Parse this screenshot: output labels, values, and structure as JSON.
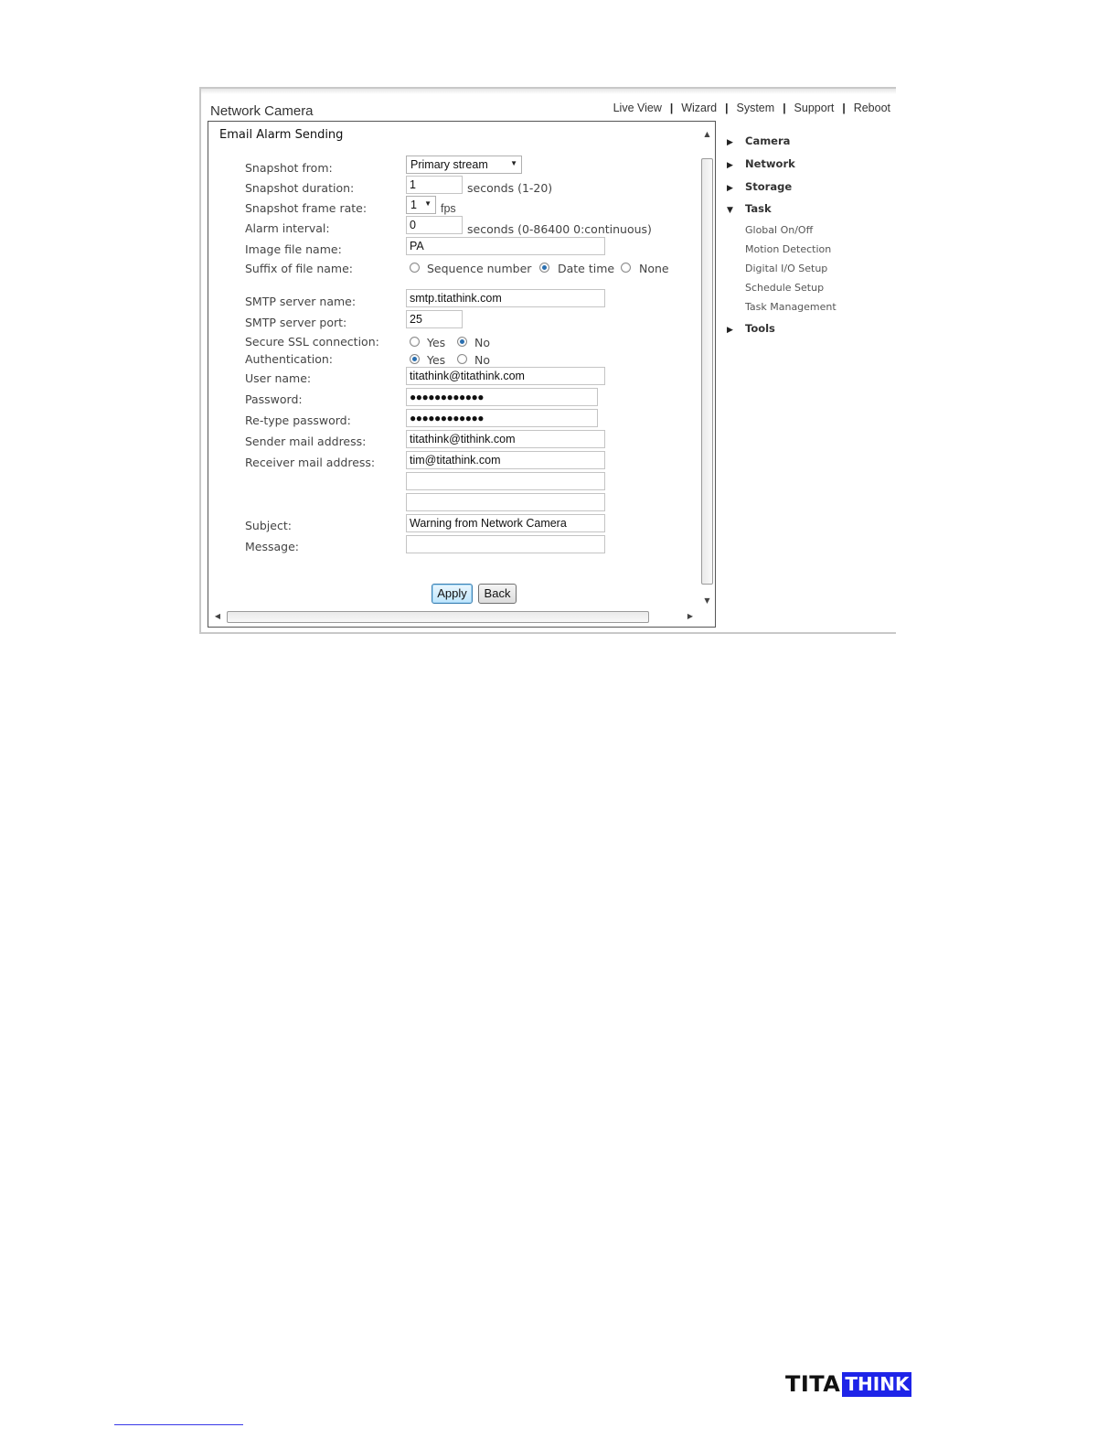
{
  "app": {
    "title": "Network Camera"
  },
  "topnav": [
    "Live View",
    "Wizard",
    "System",
    "Support",
    "Reboot"
  ],
  "panel": {
    "title": "Email Alarm Sending"
  },
  "form": {
    "snapshot_from": {
      "label": "Snapshot from:",
      "value": "Primary stream"
    },
    "snapshot_duration": {
      "label": "Snapshot duration:",
      "value": "1",
      "unit": "seconds (1-20)"
    },
    "snapshot_frame_rate": {
      "label": "Snapshot frame rate:",
      "value": "1",
      "unit": "fps"
    },
    "alarm_interval": {
      "label": "Alarm interval:",
      "value": "0",
      "unit": "seconds (0-86400 0:continuous)"
    },
    "image_file_name": {
      "label": "Image file name:",
      "value": "PA"
    },
    "suffix": {
      "label": "Suffix of file name:",
      "options": [
        "Sequence number",
        "Date time",
        "None"
      ],
      "selected": "Date time"
    },
    "smtp_server_name": {
      "label": "SMTP server name:",
      "value": "smtp.titathink.com"
    },
    "smtp_server_port": {
      "label": "SMTP server port:",
      "value": "25"
    },
    "secure_ssl": {
      "label": "Secure SSL connection:",
      "options": [
        "Yes",
        "No"
      ],
      "selected": "No"
    },
    "authentication": {
      "label": "Authentication:",
      "options": [
        "Yes",
        "No"
      ],
      "selected": "Yes"
    },
    "user_name": {
      "label": "User name:",
      "value": "titathink@titathink.com"
    },
    "password": {
      "label": "Password:",
      "value": "●●●●●●●●●●●●"
    },
    "retype_password": {
      "label": "Re-type password:",
      "value": "●●●●●●●●●●●●"
    },
    "sender": {
      "label": "Sender mail address:",
      "value": "titathink@tithink.com"
    },
    "receiver": {
      "label": "Receiver mail address:",
      "values": [
        "tim@titathink.com",
        "",
        ""
      ]
    },
    "subject": {
      "label": "Subject:",
      "value": "Warning from Network Camera"
    },
    "message": {
      "label": "Message:",
      "value": ""
    }
  },
  "buttons": {
    "apply": "Apply",
    "back": "Back"
  },
  "sidebar": {
    "sections": [
      {
        "label": "Camera",
        "expanded": false
      },
      {
        "label": "Network",
        "expanded": false
      },
      {
        "label": "Storage",
        "expanded": false
      },
      {
        "label": "Task",
        "expanded": true
      },
      {
        "label": "Tools",
        "expanded": false
      }
    ],
    "task_items": [
      "Global On/Off",
      "Motion Detection",
      "Digital I/O Setup",
      "Schedule Setup",
      "Task Management"
    ]
  },
  "logo": {
    "part1": "TITA",
    "part2": "THINK",
    "accent": "#1e24e8"
  }
}
